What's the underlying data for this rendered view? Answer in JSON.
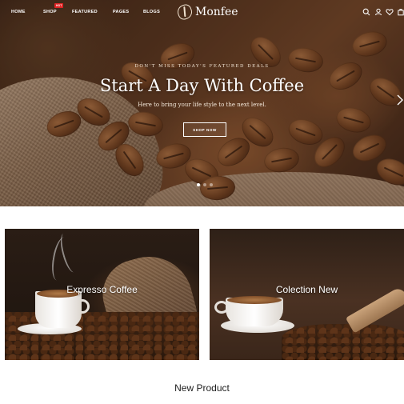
{
  "nav": {
    "items": [
      {
        "label": "HOME"
      },
      {
        "label": "SHOP"
      },
      {
        "label": "FEATURED"
      },
      {
        "label": "PAGES"
      },
      {
        "label": "BLOGS"
      }
    ],
    "shop_badge": "HOT",
    "logo_text": "Monfee",
    "icons": [
      "search-icon",
      "user-icon",
      "heart-icon",
      "cart-icon"
    ]
  },
  "hero": {
    "eyebrow": "DON'T MISS TODAY'S FEATURED DEALS",
    "headline": "Start A Day With Coffee",
    "subline": "Here to bring your life style to the next level.",
    "cta_label": "SHOP NOW",
    "slides_total": 3,
    "active_slide": 1
  },
  "banners": [
    {
      "title": "Expresso Coffee"
    },
    {
      "title": "Colection New"
    }
  ],
  "section": {
    "title": "New Product"
  },
  "colors": {
    "accent": "#e02424",
    "dark": "#1e1e1e",
    "white": "#ffffff"
  }
}
